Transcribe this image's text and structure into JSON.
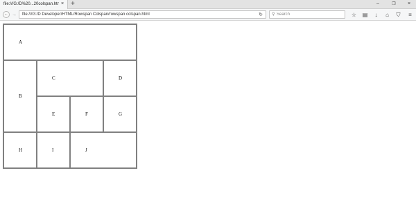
{
  "browser": {
    "tab_title": "file:///G:/D%20...20colspan.html",
    "tab_close": "×",
    "new_tab": "+",
    "window_controls": {
      "minimize": "–",
      "maximize": "❐",
      "close": "×"
    },
    "nav": {
      "back": "←",
      "forward": "→"
    },
    "url": "file:///G:/D Developer/HTML/Rowspan Colspan/rowspan colspan.html",
    "reload": "↻",
    "search": {
      "icon": "⚲",
      "placeholder": "Search"
    },
    "toolbar_icons": {
      "bookmark_star": "☆",
      "reader_view": "▤",
      "downloads": "↓",
      "home": "⌂",
      "pocket": "⛉",
      "menu": "≡"
    }
  },
  "page": {
    "cells": {
      "A": "A",
      "B": "B",
      "C": "C",
      "D": "D",
      "E": "E",
      "F": "F",
      "G": "G",
      "H": "H",
      "I": "I",
      "J": "J"
    }
  }
}
